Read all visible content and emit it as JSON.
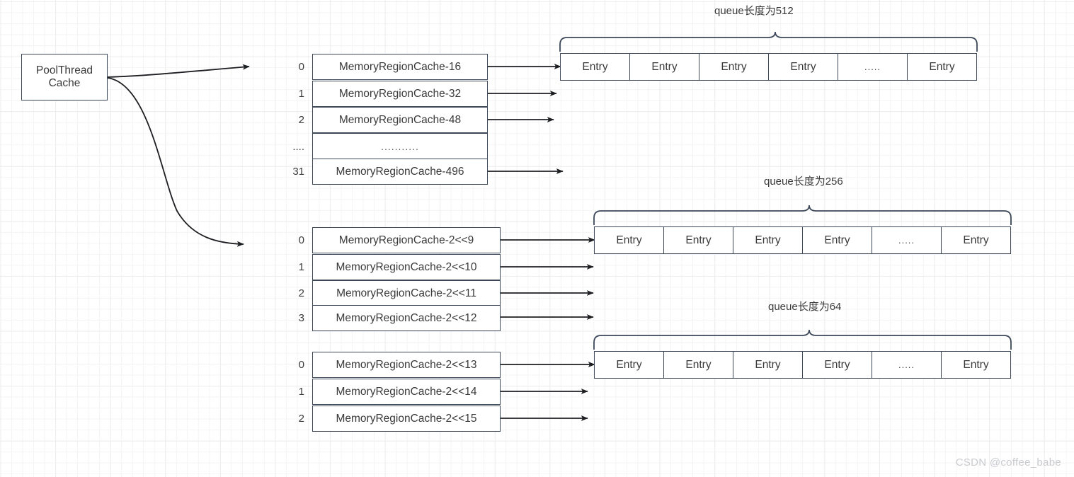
{
  "diagram": {
    "root": {
      "label": "PoolThread\nCache"
    },
    "watermark": "CSDN @coffee_babe",
    "groups": [
      {
        "id": "tiny-cache-group",
        "indices": [
          "0",
          "1",
          "2",
          "....",
          "31"
        ],
        "cells": [
          "MemoryRegionCache-16",
          "MemoryRegionCache-32",
          "MemoryRegionCache-48",
          "...........",
          "MemoryRegionCache-496"
        ],
        "queue_label": "queue长度为512",
        "entries": [
          "Entry",
          "Entry",
          "Entry",
          "Entry",
          ".....",
          "Entry"
        ]
      },
      {
        "id": "small-cache-group",
        "indices": [
          "0",
          "1",
          "2",
          "3"
        ],
        "cells": [
          "MemoryRegionCache-2<<9",
          "MemoryRegionCache-2<<10",
          "MemoryRegionCache-2<<11",
          "MemoryRegionCache-2<<12"
        ],
        "queue_label": "queue长度为256",
        "entries": [
          "Entry",
          "Entry",
          "Entry",
          "Entry",
          ".....",
          "Entry"
        ]
      },
      {
        "id": "normal-cache-group",
        "indices": [
          "0",
          "1",
          "2"
        ],
        "cells": [
          "MemoryRegionCache-2<<13",
          "MemoryRegionCache-2<<14",
          "MemoryRegionCache-2<<15"
        ],
        "queue_label": "queue长度为64",
        "entries": [
          "Entry",
          "Entry",
          "Entry",
          "Entry",
          ".....",
          "Entry"
        ]
      }
    ],
    "colors": {
      "stroke": "#3c4858",
      "text": "#3a3a3a",
      "grid_minor": "#f4f4f4",
      "grid_major": "#ededed",
      "watermark": "#c9cbcf"
    }
  }
}
